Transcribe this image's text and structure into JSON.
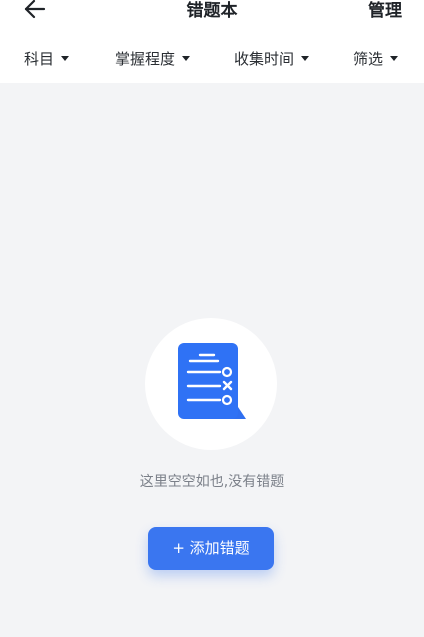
{
  "header": {
    "back_icon": "arrow-left-icon",
    "title": "错题本",
    "manage_label": "管理"
  },
  "filters": [
    {
      "label": "科目",
      "icon": "caret-down-icon"
    },
    {
      "label": "掌握程度",
      "icon": "caret-down-icon"
    },
    {
      "label": "收集时间",
      "icon": "caret-down-icon"
    },
    {
      "label": "筛选",
      "icon": "caret-down-icon"
    }
  ],
  "empty_state": {
    "icon": "document-list-icon",
    "message": "这里空空如也,没有错题",
    "add_button_label": "+ 添加错题"
  },
  "colors": {
    "accent": "#3a76f0",
    "background": "#f3f4f6",
    "surface": "#ffffff",
    "muted_text": "#7b8089"
  }
}
